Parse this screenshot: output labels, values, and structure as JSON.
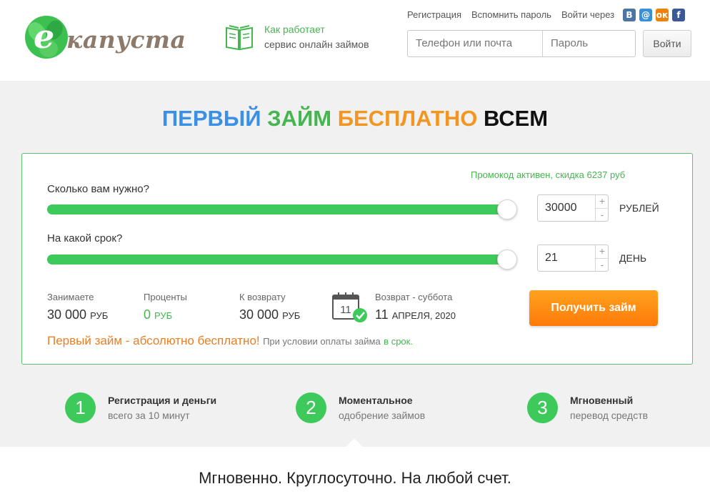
{
  "brand": {
    "logo_letter": "e",
    "name": "капуста"
  },
  "how_it_works": {
    "line1": "Как работает",
    "line2": "сервис онлайн займов"
  },
  "top_links": {
    "register": "Регистрация",
    "forgot": "Вспомнить пароль",
    "login_via": "Войти через"
  },
  "social": [
    {
      "name": "vk",
      "glyph": "В",
      "color": "#4c75a3"
    },
    {
      "name": "mail",
      "glyph": "@",
      "color": "#3a8fd9"
    },
    {
      "name": "ok",
      "glyph": "ок",
      "color": "#ee8208"
    },
    {
      "name": "facebook",
      "glyph": "f",
      "color": "#3b5998"
    }
  ],
  "login": {
    "phone_placeholder": "Телефон или почта",
    "password_placeholder": "Пароль",
    "button": "Войти"
  },
  "headline": {
    "w1": "ПЕРВЫЙ",
    "w2": "ЗАЙМ",
    "w3": "БЕСПЛАТНО",
    "w4": "ВСЕМ",
    "c1": "#3a8fe6",
    "c2": "#45b64f",
    "c3": "#f39521",
    "c4": "#111111"
  },
  "calculator": {
    "promo": "Промокод активен, скидка 6237 руб",
    "amount": {
      "label": "Сколько вам нужно?",
      "value": "30000",
      "unit": "РУБЛЕЙ",
      "fraction": 1.0,
      "plus": "+",
      "minus": "-"
    },
    "term": {
      "label": "На какой срок?",
      "value": "21",
      "unit": "ДЕНЬ",
      "fraction": 1.0,
      "plus": "+",
      "minus": "-"
    },
    "summary": {
      "borrow_label": "Занимаете",
      "borrow_value": "30 000",
      "borrow_unit": "РУБ",
      "interest_label": "Проценты",
      "interest_value": "0",
      "interest_unit": "РУБ",
      "return_label": "К возврату",
      "return_value": "30 000",
      "return_unit": "РУБ",
      "return_date_label": "Возврат - суббота",
      "return_day": "11",
      "return_month_year": "АПРЕЛЯ, 2020",
      "calendar_day": "11"
    },
    "cta": "Получить займ",
    "free_main": "Первый займ - абсолютно бесплатно!",
    "free_note": "При условии оплаты займа",
    "free_link": "в срок."
  },
  "features": [
    {
      "num": "1",
      "title": "Регистрация и деньги",
      "sub": "всего за 10 минут"
    },
    {
      "num": "2",
      "title": "Моментальное",
      "sub": "одобрение займов"
    },
    {
      "num": "3",
      "title": "Мгновенный",
      "sub": "перевод средств"
    }
  ],
  "tagline": "Мгновенно. Круглосуточно. На любой счет."
}
